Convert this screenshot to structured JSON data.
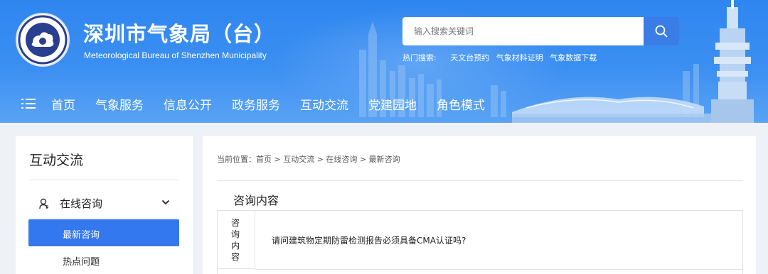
{
  "header": {
    "title": "深圳市气象局（台）",
    "subtitle": "Meteorological Bureau of Shenzhen Municipality",
    "search": {
      "placeholder": "输入搜索关键词"
    },
    "hot_search": {
      "label": "热门搜索:",
      "links": [
        "天文台预约",
        "气象材料证明",
        "气象数据下载"
      ]
    },
    "nav": [
      "首页",
      "气象服务",
      "信息公开",
      "政务服务",
      "互动交流",
      "党建园地",
      "角色模式"
    ]
  },
  "sidebar": {
    "title": "互动交流",
    "group": "在线咨询",
    "items": [
      "最新咨询",
      "热点问题"
    ]
  },
  "main": {
    "breadcrumb": "当前位置：首页 > 互动交流 > 在线咨询 > 最新咨询",
    "section_title": "咨询内容",
    "table": {
      "label": "咨询内容",
      "content": "请问建筑物定期防雷检测报告必须具备CMA认证吗?"
    }
  },
  "colors": {
    "header_blue": "#2f86ef",
    "accent": "#3478ef",
    "search_button": "#3a7de6"
  }
}
